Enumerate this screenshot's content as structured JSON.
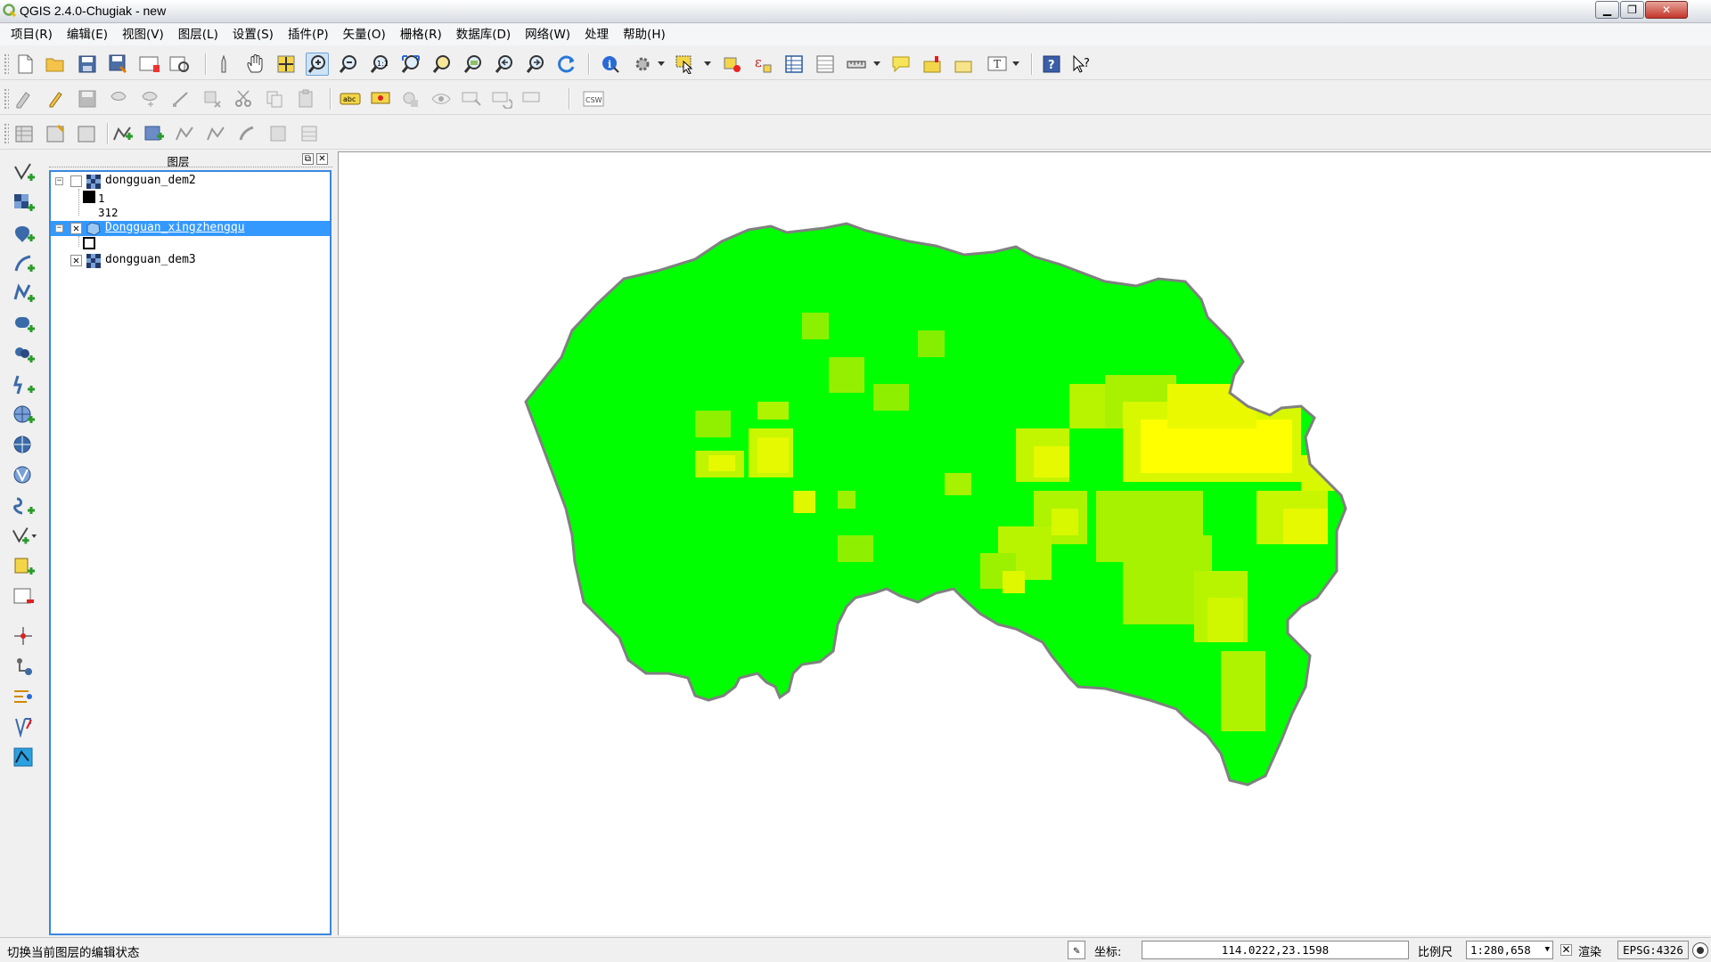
{
  "window": {
    "title": "QGIS 2.4.0-Chugiak - new",
    "controls": [
      "minimize",
      "maximize",
      "close"
    ]
  },
  "menubar": {
    "items": [
      {
        "label": "项目(R)"
      },
      {
        "label": "编辑(E)"
      },
      {
        "label": "视图(V)"
      },
      {
        "label": "图层(L)"
      },
      {
        "label": "设置(S)"
      },
      {
        "label": "插件(P)"
      },
      {
        "label": "矢量(O)"
      },
      {
        "label": "栅格(R)"
      },
      {
        "label": "数据库(D)"
      },
      {
        "label": "网络(W)"
      },
      {
        "label": "处理"
      },
      {
        "label": "帮助(H)"
      }
    ]
  },
  "toolbars": {
    "csw_label": "CSW",
    "abc_label": "abc"
  },
  "layers_panel": {
    "title": "图层",
    "layers": [
      {
        "name": "dongguan_dem2",
        "checked": false,
        "expanded": true,
        "legend_min": "1",
        "legend_max": "312"
      },
      {
        "name": "Dongguan_xingzhengqu",
        "checked": true,
        "expanded": true,
        "selected": true
      },
      {
        "name": "dongguan_dem3",
        "checked": true,
        "expanded": false
      }
    ]
  },
  "map": {
    "colors": {
      "low": "#00ff00",
      "mid": "#7fff00",
      "high": "#ffff00",
      "boundary": "#808080"
    }
  },
  "statusbar": {
    "message": "切换当前图层的编辑状态",
    "coordinate_label": "坐标:",
    "coordinate_value": "114.0222,23.1598",
    "scale_label": "比例尺",
    "scale_value": "1:280,658",
    "render_label": "渲染",
    "render_checked": true,
    "crs": "EPSG:4326"
  }
}
